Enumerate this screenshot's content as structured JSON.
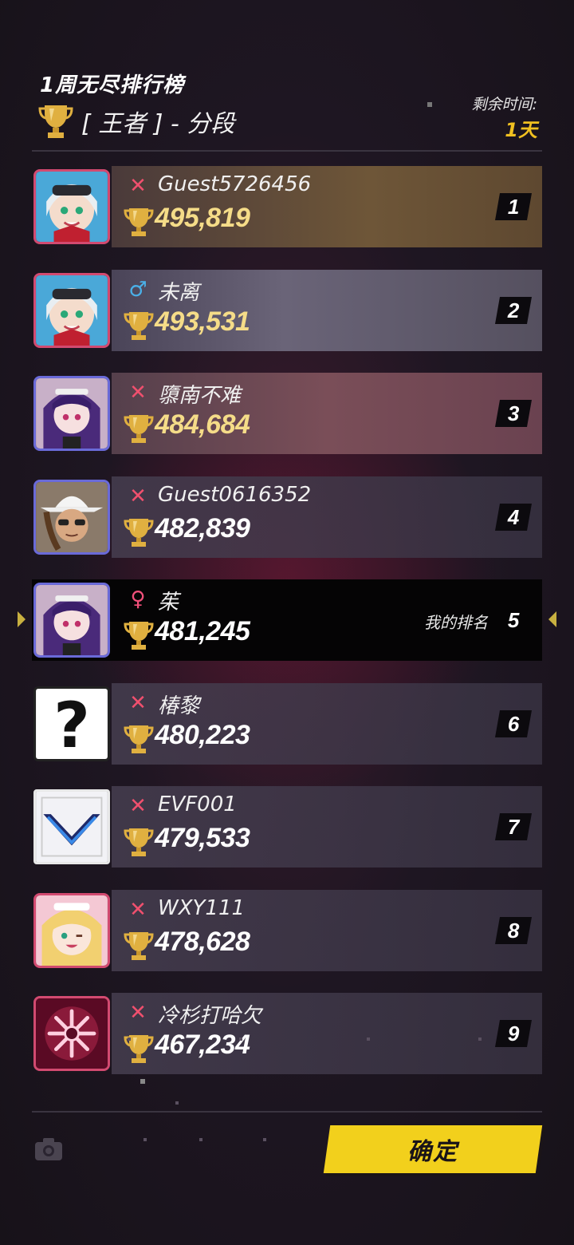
{
  "header": {
    "title": "1周无尽排行榜",
    "tier_label": "[ 王者 ] - 分段",
    "time_label": "剩余时间:",
    "time_value": "1天"
  },
  "my_rank_label": "我的排名",
  "ranking": [
    {
      "rank": "1",
      "name": "Guest5726456",
      "score": "495,819",
      "gender": "unknown",
      "gender_glyph": "✕",
      "avatar": "white-haired-goggles-avatar"
    },
    {
      "rank": "2",
      "name": "未离",
      "score": "493,531",
      "gender": "male",
      "gender_glyph": "♂",
      "avatar": "white-haired-goggles-avatar"
    },
    {
      "rank": "3",
      "name": "隳南不难",
      "score": "484,684",
      "gender": "unknown",
      "gender_glyph": "✕",
      "avatar": "purple-haired-maid-avatar"
    },
    {
      "rank": "4",
      "name": "Guest0616352",
      "score": "482,839",
      "gender": "unknown",
      "gender_glyph": "✕",
      "avatar": "white-hat-sunglasses-avatar"
    },
    {
      "rank": "5",
      "name": "茱",
      "score": "481,245",
      "gender": "female",
      "gender_glyph": "♀",
      "avatar": "purple-haired-maid-avatar",
      "is_me": true
    },
    {
      "rank": "6",
      "name": "椿黎",
      "score": "480,223",
      "gender": "unknown",
      "gender_glyph": "✕",
      "avatar": "question-mark-avatar"
    },
    {
      "rank": "7",
      "name": "EVF001",
      "score": "479,533",
      "gender": "unknown",
      "gender_glyph": "✕",
      "avatar": "blue-chevron-emblem-avatar"
    },
    {
      "rank": "8",
      "name": "WXY111",
      "score": "478,628",
      "gender": "unknown",
      "gender_glyph": "✕",
      "avatar": "blonde-winking-girl-avatar"
    },
    {
      "rank": "9",
      "name": "冷杉打哈欠",
      "score": "467,234",
      "gender": "unknown",
      "gender_glyph": "✕",
      "avatar": "pink-snowflake-emblem-avatar"
    }
  ],
  "footer": {
    "confirm_label": "确定",
    "camera_icon": "camera-icon"
  },
  "colors": {
    "accent_yellow": "#f2d01c",
    "gold_score": "#f5dc88",
    "gender_x": "#f0506e",
    "gender_male": "#4ab0e8",
    "gender_female": "#f0507a"
  }
}
